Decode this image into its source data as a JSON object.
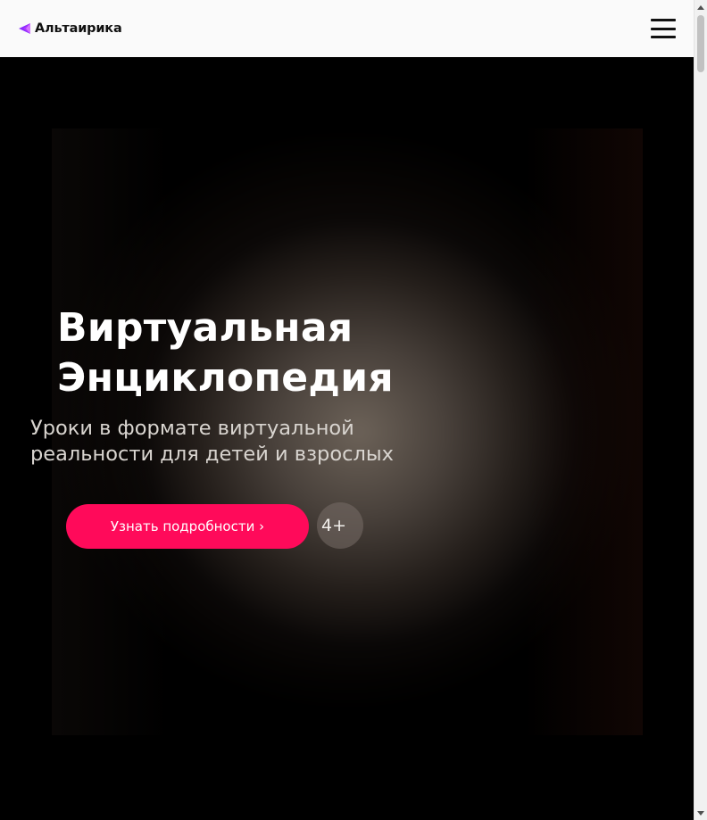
{
  "header": {
    "brand_name": "Альтаирика",
    "brand_color": "#8b2cff",
    "menu_icon": "hamburger-menu-icon"
  },
  "hero": {
    "title_lines": [
      "Виртуальная",
      "Энциклопедия"
    ],
    "subtitle_lines": [
      "Уроки в формате виртуальной",
      "реальности для детей и взрослых"
    ],
    "cta_label": "Узнать подробности ›",
    "cta_color": "#ff0a5a",
    "age_rating": "4+"
  },
  "scrollbar": {
    "up_icon": "scroll-up-arrow-icon",
    "down_icon": "scroll-down-arrow-icon"
  }
}
